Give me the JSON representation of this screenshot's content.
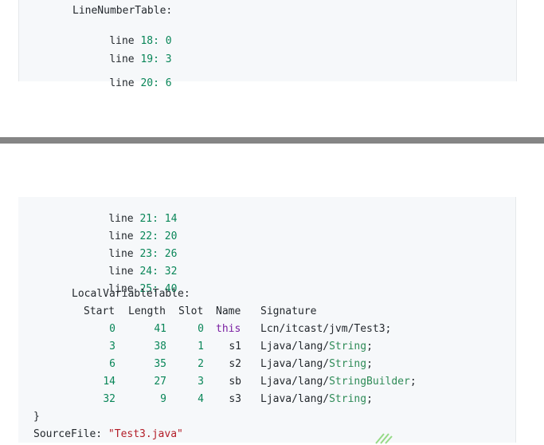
{
  "top": {
    "heading": "LineNumberTable:",
    "lines": [
      {
        "label": "line",
        "num": "18:",
        "val": "0"
      },
      {
        "label": "line",
        "num": "19:",
        "val": "3"
      },
      {
        "label": "line",
        "num": "20:",
        "val": "6"
      }
    ]
  },
  "bottom": {
    "lines": [
      {
        "label": "line",
        "num": "21:",
        "val": "14"
      },
      {
        "label": "line",
        "num": "22:",
        "val": "20"
      },
      {
        "label": "line",
        "num": "23:",
        "val": "26"
      },
      {
        "label": "line",
        "num": "24:",
        "val": "32"
      },
      {
        "label": "line",
        "num": "25:",
        "val": "40"
      }
    ],
    "lvt_heading": "LocalVariableTable:",
    "columns": [
      "Start",
      "Length",
      "Slot",
      "Name",
      "Signature"
    ],
    "rows": [
      {
        "start": "0",
        "length": "41",
        "slot": "0",
        "name": "this",
        "sig_prefix": "Lcn/itcast/jvm/Test3;",
        "sig_type": "",
        "sig_suffix": ""
      },
      {
        "start": "3",
        "length": "38",
        "slot": "1",
        "name": "s1",
        "sig_prefix": "Ljava/lang/",
        "sig_type": "String",
        "sig_suffix": ";"
      },
      {
        "start": "6",
        "length": "35",
        "slot": "2",
        "name": "s2",
        "sig_prefix": "Ljava/lang/",
        "sig_type": "String",
        "sig_suffix": ";"
      },
      {
        "start": "14",
        "length": "27",
        "slot": "3",
        "name": "sb",
        "sig_prefix": "Ljava/lang/",
        "sig_type": "StringBuilder",
        "sig_suffix": ";"
      },
      {
        "start": "32",
        "length": "9",
        "slot": "4",
        "name": "s3",
        "sig_prefix": "Ljava/lang/",
        "sig_type": "String",
        "sig_suffix": ";"
      }
    ],
    "closing_brace": "}",
    "source_label": "SourceFile:",
    "source_value": "\"Test3.java\""
  },
  "colors": {
    "number": "#098658",
    "keyword": "#7a1fa2",
    "type": "#2e8b57",
    "string": "#b31d28",
    "divider": "#858585",
    "panel": "#f6f8fa"
  }
}
